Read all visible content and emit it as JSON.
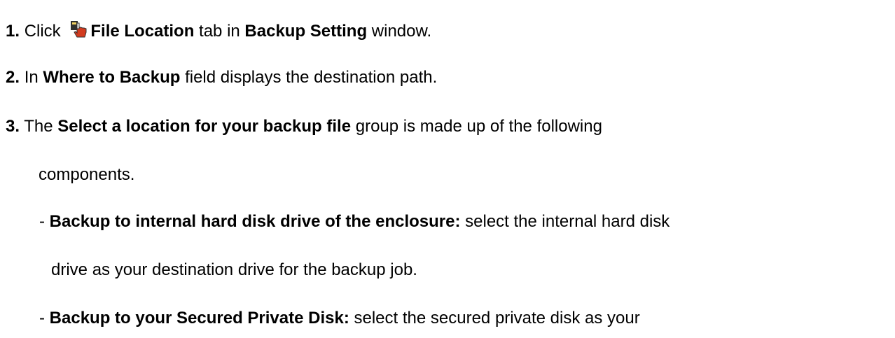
{
  "steps": [
    {
      "number": "1.",
      "pre": "Click ",
      "icon": "tab-hand-icon",
      "bold1": "File Location",
      "mid": " tab in ",
      "bold2": "Backup Setting",
      "post": " window."
    },
    {
      "number": "2.",
      "pre": "In ",
      "bold1": "Where to Backup",
      "post": " field displays the destination path."
    },
    {
      "number": "3.",
      "pre": "The ",
      "bold1": "Select a location for your backup file",
      "post": " group is made up of the following",
      "cont": "components."
    }
  ],
  "bullets": [
    {
      "dash": "-",
      "bold": "Backup to internal hard disk drive of the enclosure:",
      "text": " select the internal hard disk",
      "cont": "drive as your destination drive for the backup job."
    },
    {
      "dash": "-",
      "bold": "Backup to your Secured Private Disk:",
      "text": " select the secured private disk as your"
    }
  ],
  "colors": {
    "text": "#000000",
    "icon_dark": "#2f2f2f",
    "icon_accent": "#d23b1f",
    "icon_light": "#f0d060"
  }
}
